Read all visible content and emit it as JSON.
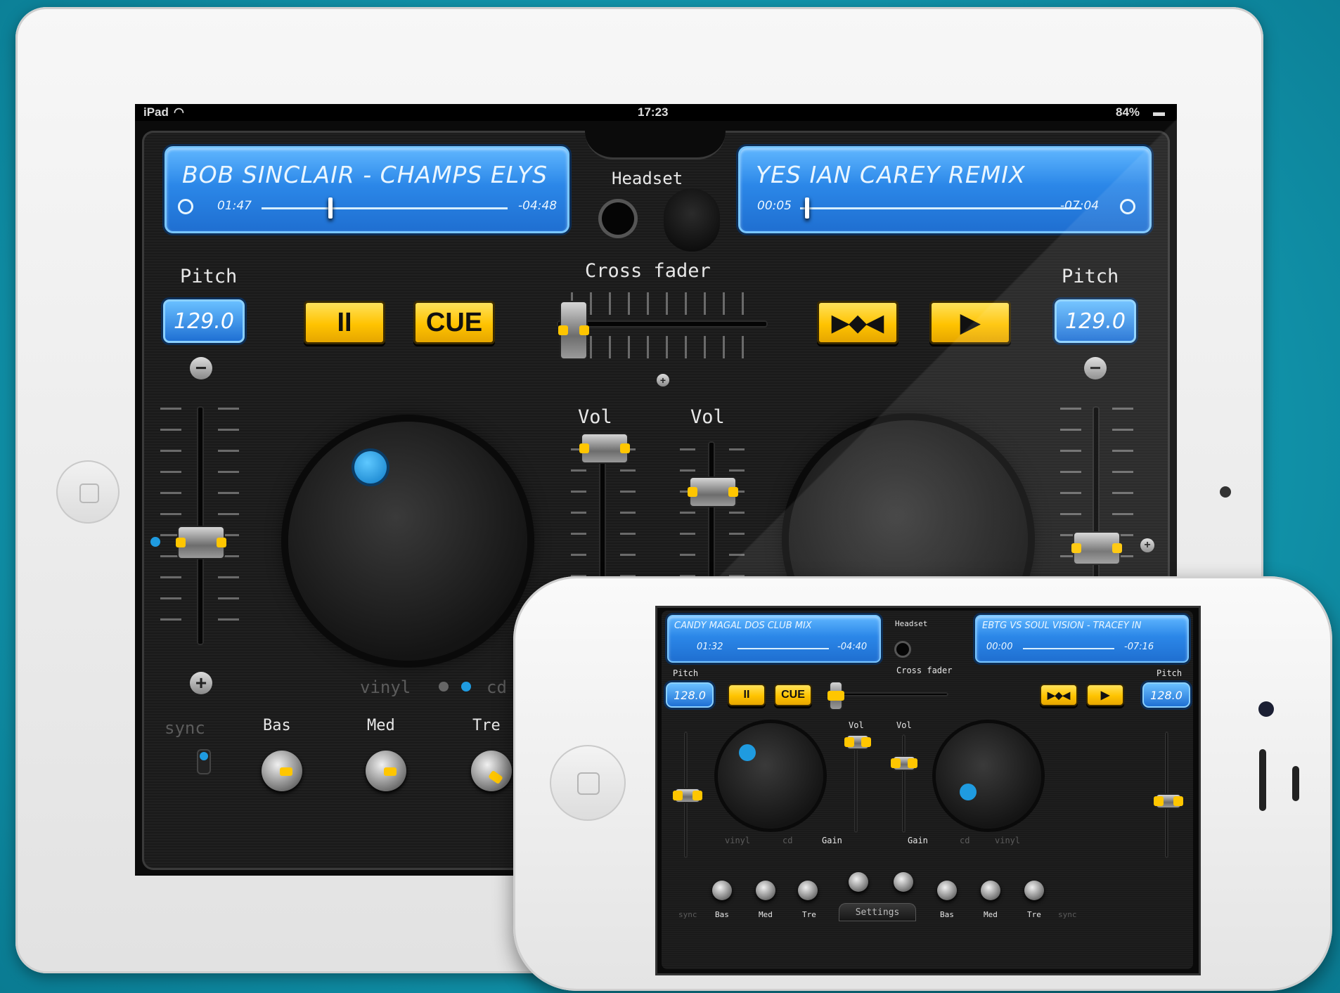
{
  "ipad": {
    "status": {
      "carrier": "iPad",
      "time": "17:23",
      "battery": "84%"
    },
    "deck_a": {
      "track_title": "BOB SINCLAIR - CHAMPS ELYSEES (J",
      "elapsed": "01:47",
      "remaining": "-04:48",
      "position": 0.27,
      "pitch_label": "Pitch",
      "pitch_value": "129.0",
      "pause_label": "II",
      "cue_label": "CUE",
      "vinyl_label": "vinyl",
      "cd_label": "cd",
      "sync_label": "sync",
      "eq": {
        "bass": "Bas",
        "mid": "Med",
        "treble": "Tre"
      }
    },
    "deck_b": {
      "track_title": "YES IAN CAREY REMIX",
      "elapsed": "00:05",
      "remaining": "-07:04",
      "position": 0.02,
      "pitch_label": "Pitch",
      "pitch_value": "129.0"
    },
    "mixer": {
      "headset_label": "Headset",
      "crossfader_label": "Cross fader",
      "vol_a_label": "Vol",
      "vol_b_label": "Vol"
    }
  },
  "iphone": {
    "deck_a": {
      "track_title": "CANDY MAGAL DOS CLUB MIX",
      "elapsed": "01:32",
      "remaining": "-04:40",
      "pitch_label": "Pitch",
      "pitch_value": "128.0",
      "vinyl_label": "vinyl",
      "cd_label": "cd",
      "sync_label": "sync"
    },
    "deck_b": {
      "track_title": "EBTG VS SOUL VISION - TRACEY IN",
      "elapsed": "00:00",
      "remaining": "-07:16",
      "pitch_label": "Pitch",
      "pitch_value": "128.0",
      "vinyl_label": "vinyl",
      "cd_label": "cd",
      "sync_label": "sync"
    },
    "mixer": {
      "headset_label": "Headset",
      "crossfader_label": "Cross fader",
      "vol_label": "Vol",
      "gain_label": "Gain"
    },
    "buttons": {
      "pause": "II",
      "cue": "CUE"
    },
    "eq": {
      "bass": "Bas",
      "mid": "Med",
      "treble": "Tre"
    },
    "settings_label": "Settings"
  },
  "colors": {
    "background": "#1296ad",
    "lcd_blue": "#2b87e8",
    "button_yellow": "#ffc300",
    "jog_dot": "#1f9be0"
  }
}
